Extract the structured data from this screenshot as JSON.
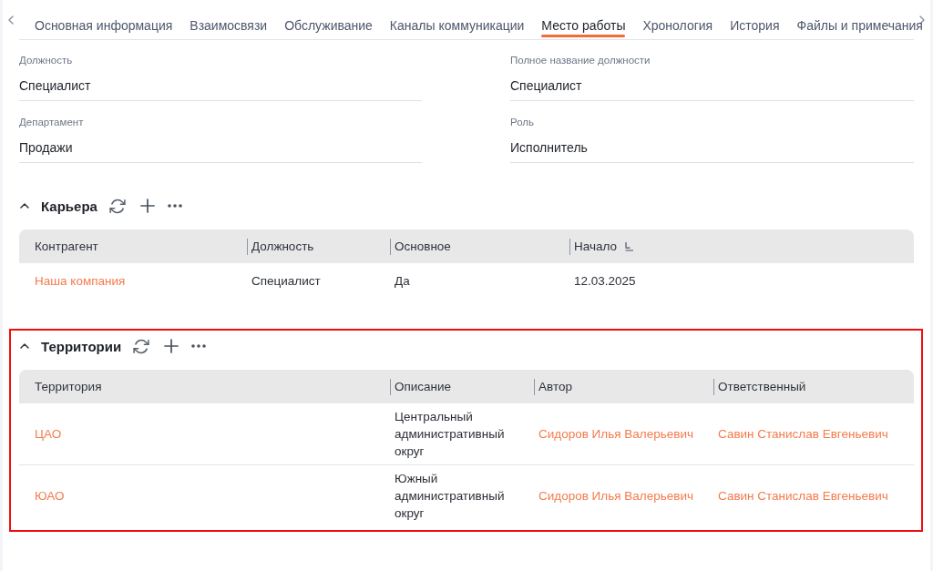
{
  "tabs": [
    {
      "label": "Основная информация",
      "selected": false
    },
    {
      "label": "Взаимосвязи",
      "selected": false
    },
    {
      "label": "Обслуживание",
      "selected": false
    },
    {
      "label": "Каналы коммуникации",
      "selected": false
    },
    {
      "label": "Место работы",
      "selected": true
    },
    {
      "label": "Хронология",
      "selected": false
    },
    {
      "label": "История",
      "selected": false
    },
    {
      "label": "Файлы и примечания",
      "selected": false
    }
  ],
  "fields": [
    {
      "label": "Должность",
      "value": "Специалист"
    },
    {
      "label": "Полное название должности",
      "value": "Специалист"
    },
    {
      "label": "Департамент",
      "value": "Продажи"
    },
    {
      "label": "Роль",
      "value": "Исполнитель"
    }
  ],
  "sections": [
    {
      "title": "Карьера",
      "expanded": true,
      "highlighted": false,
      "table": {
        "columns": [
          {
            "label": "Контрагент",
            "sorted": false
          },
          {
            "label": "Должность",
            "sorted": false
          },
          {
            "label": "Основное",
            "sorted": false
          },
          {
            "label": "Начало",
            "sorted": true
          }
        ],
        "rows": [
          {
            "cells": [
              {
                "kind": "link",
                "text": "Наша компания"
              },
              {
                "kind": "text",
                "text": "Специалист"
              },
              {
                "kind": "text",
                "text": "Да"
              },
              {
                "kind": "text",
                "text": "12.03.2025"
              }
            ]
          }
        ]
      }
    },
    {
      "title": "Территории",
      "expanded": true,
      "highlighted": true,
      "table": {
        "columns": [
          {
            "label": "Территория",
            "sorted": false
          },
          {
            "label": "Описание",
            "sorted": false
          },
          {
            "label": "Автор",
            "sorted": false
          },
          {
            "label": "Ответственный",
            "sorted": false
          }
        ],
        "rows": [
          {
            "cells": [
              {
                "kind": "link",
                "text": "ЦАО"
              },
              {
                "kind": "text",
                "text": "Центральный административный округ"
              },
              {
                "kind": "link",
                "text": "Сидоров Илья Валерьевич"
              },
              {
                "kind": "link",
                "text": "Савин Станислав Евгеньевич"
              }
            ]
          },
          {
            "cells": [
              {
                "kind": "link",
                "text": "ЮАО"
              },
              {
                "kind": "text",
                "text": "Южный административный округ"
              },
              {
                "kind": "link",
                "text": "Сидоров Илья Валерьевич"
              },
              {
                "kind": "link",
                "text": "Савин Станислав Евгеньевич"
              }
            ]
          }
        ]
      }
    }
  ]
}
